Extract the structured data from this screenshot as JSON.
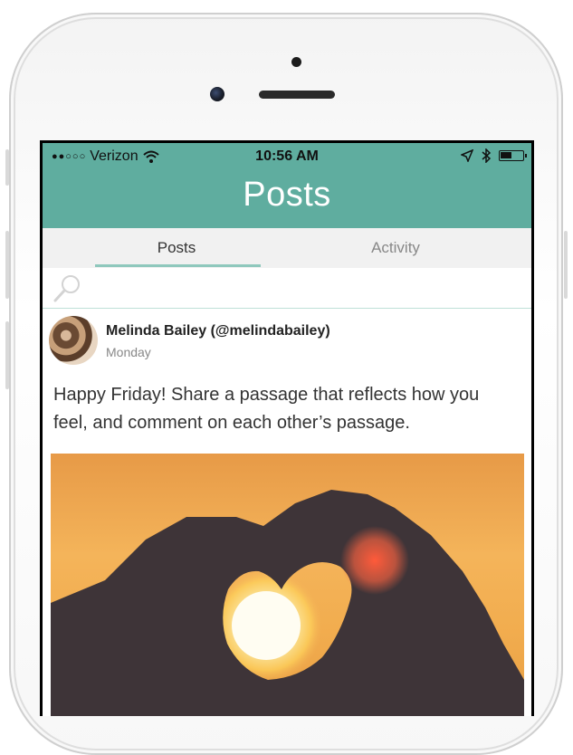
{
  "status_bar": {
    "signal": "●●○○○",
    "carrier": "Verizon",
    "time": "10:56 AM"
  },
  "header": {
    "title": "Posts"
  },
  "tabs": [
    {
      "label": "Posts"
    },
    {
      "label": "Activity"
    }
  ],
  "search": {
    "icon": "search-icon"
  },
  "post": {
    "author": "Melinda Bailey (@melindabailey)",
    "date": "Monday",
    "text": "Happy Friday!  Share a passage that reflects how you feel, and comment on each other’s passage."
  },
  "colors": {
    "header": "#5fad9f",
    "tab_underline": "#8fc8bd",
    "tabs_background": "#f1f1f1"
  }
}
